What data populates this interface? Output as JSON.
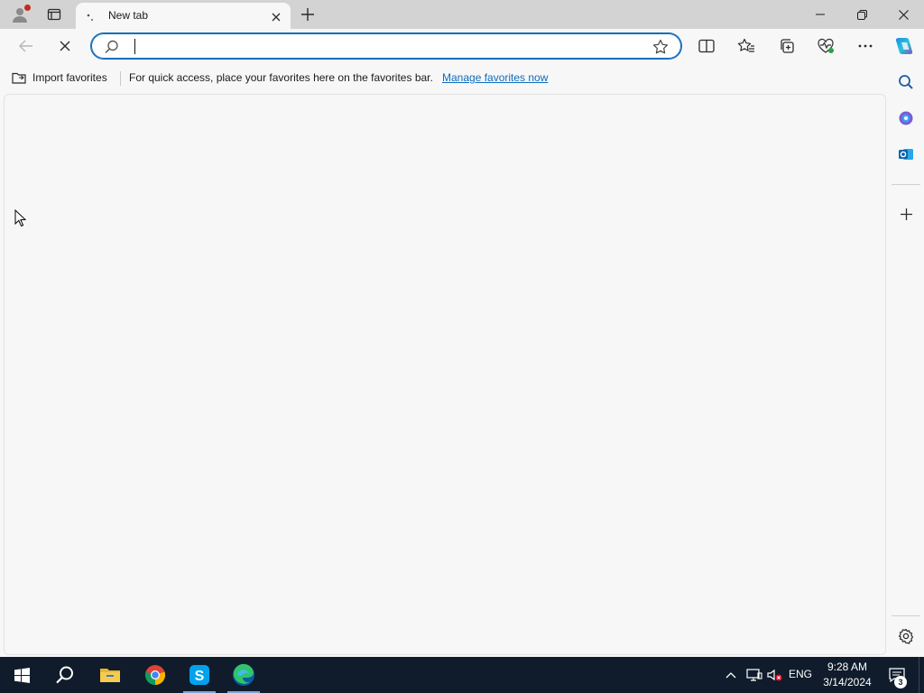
{
  "titlebar": {
    "active_tab": {
      "title": "New tab"
    }
  },
  "toolbar": {
    "address": {
      "value": "",
      "placeholder": ""
    }
  },
  "favorites_bar": {
    "import_label": "Import favorites",
    "message": "For quick access, place your favorites here on the favorites bar.",
    "manage_link": "Manage favorites now"
  },
  "taskbar": {
    "language": "ENG",
    "time": "9:28 AM",
    "date": "3/14/2024",
    "notification_count": "3"
  },
  "colors": {
    "accent": "#0f6cbd",
    "taskbar": "#101c2b",
    "titlebar": "#d3d3d3",
    "page": "#f7f7f7"
  },
  "icons": {
    "titlebar": [
      "profile-icon",
      "tab-actions-icon",
      "loading-icon",
      "close-icon",
      "plus-icon",
      "minimize-icon",
      "restore-icon",
      "close-window-icon"
    ],
    "toolbar": [
      "back-arrow-icon",
      "stop-icon",
      "search-icon",
      "star-icon",
      "split-screen-icon",
      "favorites-icon",
      "collections-icon",
      "performance-icon",
      "more-icon",
      "copilot-icon"
    ],
    "sidebar": [
      "search-icon",
      "microsoft-365-icon",
      "outlook-icon",
      "plus-icon",
      "gear-icon"
    ],
    "taskbar": [
      "windows-icon",
      "search-icon",
      "folder-icon",
      "chrome-icon",
      "skype-icon",
      "edge-icon",
      "chevron-up-icon",
      "network-icon",
      "volume-muted-icon",
      "notification-icon"
    ]
  }
}
